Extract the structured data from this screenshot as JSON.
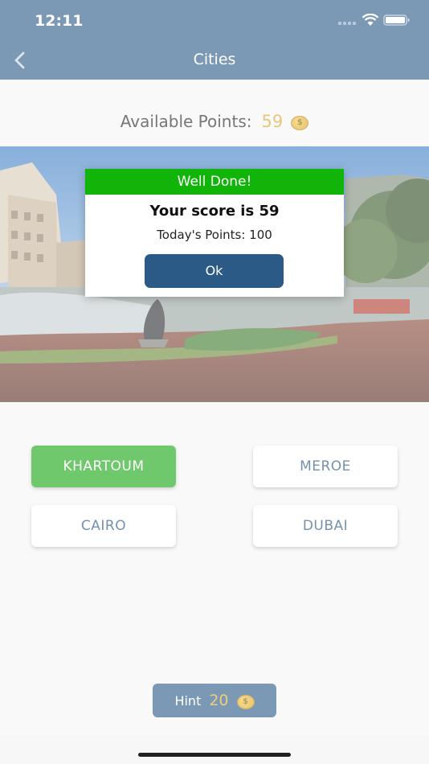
{
  "status_bar": {
    "time": "12:11"
  },
  "nav": {
    "title": "Cities"
  },
  "points": {
    "label": "Available Points:",
    "value": "59",
    "coin_symbol": "$"
  },
  "answers": [
    {
      "label": "KHARTOUM",
      "state": "correct"
    },
    {
      "label": "MEROE",
      "state": "default"
    },
    {
      "label": "CAIRO",
      "state": "default"
    },
    {
      "label": "DUBAI",
      "state": "default"
    }
  ],
  "hint": {
    "label": "Hint",
    "value": "20"
  },
  "modal": {
    "header": "Well Done!",
    "score_text": "Your score is 59",
    "points_text": "Today's Points: 100",
    "ok_label": "Ok"
  },
  "colors": {
    "nav_bg": "#2b5a86",
    "correct_green": "#18a813",
    "modal_header_green": "#11b50a",
    "coin_gold": "#d9a52b"
  }
}
